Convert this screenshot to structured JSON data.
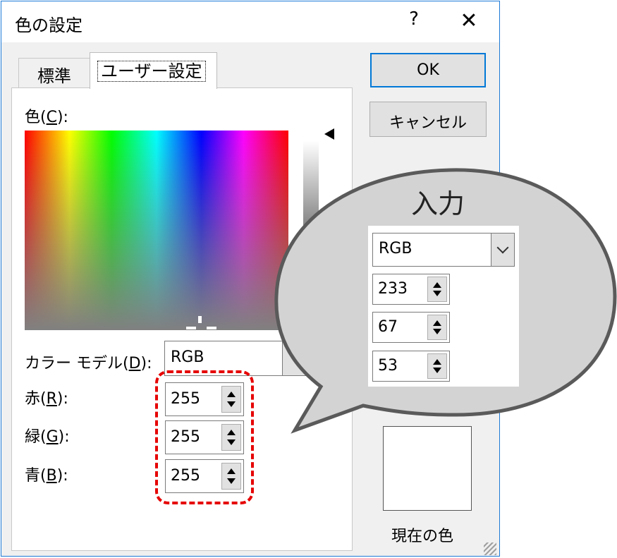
{
  "window": {
    "title": "色の設定",
    "help": "?",
    "close": "✕"
  },
  "tabs": [
    {
      "label": "標準"
    },
    {
      "label": "ユーザー設定"
    }
  ],
  "buttons": {
    "ok": "OK",
    "cancel": "キャンセル"
  },
  "color_label": {
    "text": "色(",
    "key": "C",
    "suffix": "):"
  },
  "color_model": {
    "label_text": "カラー モデル(",
    "key": "D",
    "suffix": "):",
    "value": "RGB"
  },
  "red": {
    "label": "赤(",
    "key": "R",
    "suffix": "):",
    "value": "255"
  },
  "green": {
    "label": "緑(",
    "key": "G",
    "suffix": "):",
    "value": "255"
  },
  "blue": {
    "label": "青(",
    "key": "B",
    "suffix": "):",
    "value": "255"
  },
  "current_color": {
    "label": "現在の色",
    "color": "#ffffff"
  },
  "callout": {
    "title": "入力",
    "model": "RGB",
    "red": "233",
    "green": "67",
    "blue": "53"
  },
  "colors": {
    "highlight": "#e60000",
    "accent": "#0078d7"
  },
  "icons": [
    "help-icon",
    "close-icon",
    "chevron-down-icon",
    "spin-up-icon",
    "spin-down-icon",
    "luminance-arrow-icon"
  ]
}
